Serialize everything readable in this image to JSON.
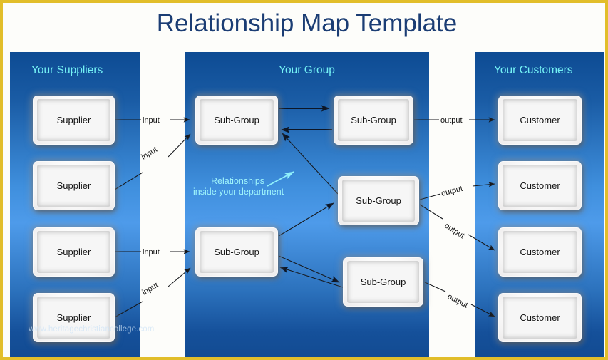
{
  "page": {
    "title": "Relationship Map Template",
    "border_color": "#e2be2a",
    "title_color": "#1b3d74",
    "background": "#fdfdfa",
    "watermark": "www.heritagechristiancollege.com"
  },
  "panels": {
    "suppliers": {
      "title": "Your Suppliers",
      "title_color": "#74f2f5",
      "nodes": [
        {
          "label": "Supplier"
        },
        {
          "label": "Supplier"
        },
        {
          "label": "Supplier"
        },
        {
          "label": "Supplier"
        }
      ]
    },
    "group": {
      "title": "Your Group",
      "title_color": "#74f2f5",
      "nodes": [
        {
          "label": "Sub-Group"
        },
        {
          "label": "Sub-Group"
        },
        {
          "label": "Sub-Group"
        },
        {
          "label": "Sub-Group"
        }
      ]
    },
    "customers": {
      "title": "Your Customers",
      "title_color": "#74f2f5",
      "nodes": [
        {
          "label": "Customer"
        },
        {
          "label": "Customer"
        },
        {
          "label": "Customer"
        },
        {
          "label": "Customer"
        }
      ]
    }
  },
  "annotation": {
    "line1": "Relationships",
    "line2": "inside your department",
    "color": "#9ff4fb",
    "arrow": "cyan-arrow-icon"
  },
  "connectors": {
    "input_labels": [
      "input",
      "input",
      "input",
      "input"
    ],
    "output_labels": [
      "output",
      "output",
      "output",
      "output"
    ],
    "input_label": "input",
    "output_label": "output"
  }
}
